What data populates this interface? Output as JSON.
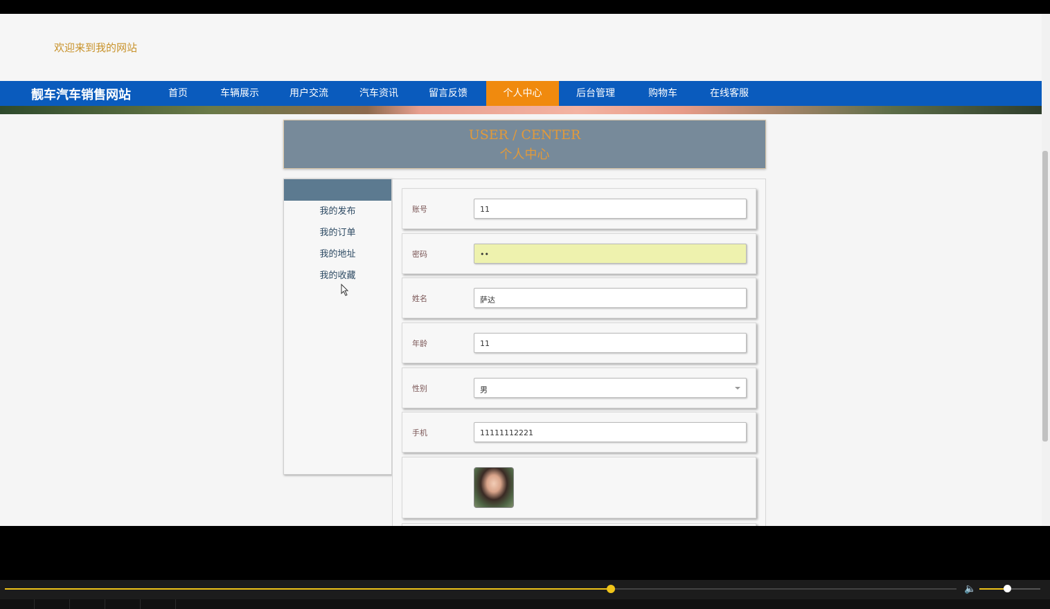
{
  "welcome": "欢迎来到我的网站",
  "nav": {
    "brand": "靓车汽车销售网站",
    "items": [
      "首页",
      "车辆展示",
      "用户交流",
      "汽车资讯",
      "留言反馈",
      "个人中心",
      "后台管理",
      "购物车",
      "在线客服"
    ],
    "active": "个人中心"
  },
  "header": {
    "en": "USER / CENTER",
    "cn": "个人中心"
  },
  "sidebar": {
    "links": [
      "我的发布",
      "我的订单",
      "我的地址",
      "我的收藏"
    ]
  },
  "form": {
    "account": {
      "label": "账号",
      "value": "11"
    },
    "password": {
      "label": "密码",
      "value": "••"
    },
    "name": {
      "label": "姓名",
      "value": "萨达"
    },
    "age": {
      "label": "年龄",
      "value": "11"
    },
    "gender": {
      "label": "性别",
      "value": "男"
    },
    "phone": {
      "label": "手机",
      "value": "11111112221"
    }
  },
  "player": {
    "seek_progress": 0.637,
    "volume": 0.45
  },
  "colors": {
    "nav": "#0a5bbd",
    "active": "#f08a0e",
    "accent": "#e29a3a",
    "seek": "#f0c419"
  }
}
